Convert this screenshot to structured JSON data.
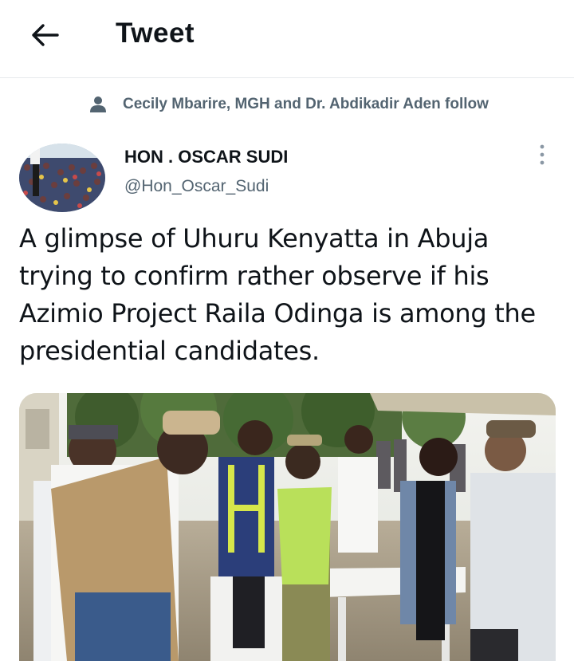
{
  "header": {
    "back_icon": "arrow-left-icon",
    "title": "Tweet"
  },
  "social_context": {
    "icon": "person-icon",
    "text": "Cecily Mbarire, MGH and Dr. Abdikadir Aden follow"
  },
  "tweet": {
    "author_name": "HON . OSCAR SUDI",
    "author_handle": "@Hon_Oscar_Sudi",
    "more_icon": "more-vertical-icon",
    "text": "A glimpse of Uhuru Kenyatta in Abuja trying to confirm rather observe if his Azimio Project Raila Odinga is among the presidential candidates.",
    "media_type": "photo"
  },
  "colors": {
    "primary_text": "#0f1419",
    "secondary_text": "#536471",
    "divider": "#e6e9ec",
    "background": "#ffffff"
  }
}
